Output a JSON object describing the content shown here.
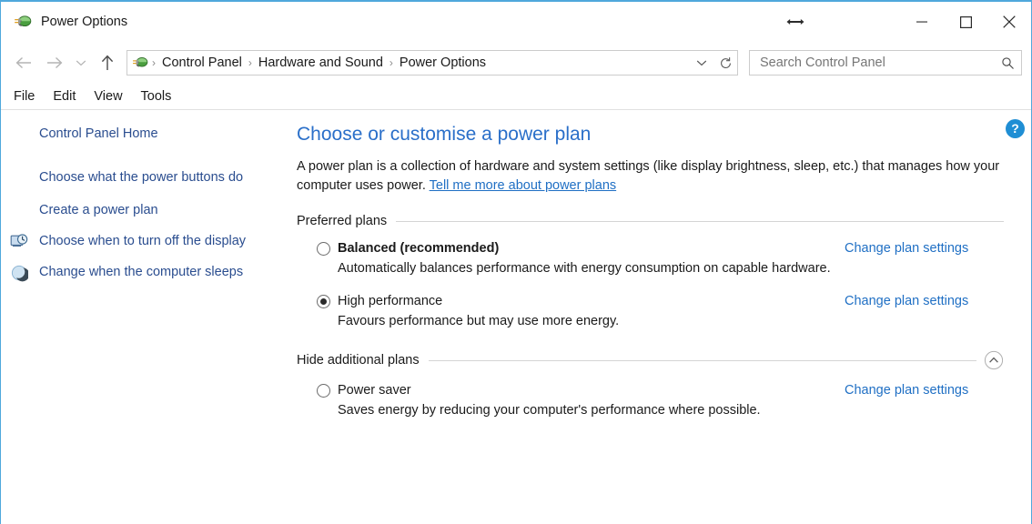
{
  "window": {
    "title": "Power Options",
    "title_icon": "power-plug-icon",
    "cursor": "horizontal-resize-cursor",
    "controls": {
      "minimize": "minimize-icon",
      "maximize": "maximize-icon",
      "close": "close-icon"
    }
  },
  "nav": {
    "back": "back-arrow-icon",
    "forward": "forward-arrow-icon",
    "recent": "chevron-down-icon",
    "up": "up-arrow-icon",
    "crumb_icon": "power-plug-icon",
    "breadcrumbs": [
      "Control Panel",
      "Hardware and Sound",
      "Power Options"
    ],
    "separator": "›",
    "dropdown": "chevron-down-icon",
    "refresh": "refresh-icon"
  },
  "search": {
    "placeholder": "Search Control Panel",
    "value": "",
    "icon": "search-icon"
  },
  "menu": {
    "items": [
      "File",
      "Edit",
      "View",
      "Tools"
    ]
  },
  "sidebar": {
    "items": [
      {
        "label": "Control Panel Home",
        "icon": ""
      },
      {
        "label": "Choose what the power buttons do",
        "icon": ""
      },
      {
        "label": "Create a power plan",
        "icon": ""
      },
      {
        "label": "Choose when to turn off the display",
        "icon": "display-clock-icon"
      },
      {
        "label": "Change when the computer sleeps",
        "icon": "moon-sleep-icon"
      }
    ]
  },
  "content": {
    "help_button": "?",
    "title": "Choose or customise a power plan",
    "description_prefix": "A power plan is a collection of hardware and system settings (like display brightness, sleep, etc.) that manages how your computer uses power. ",
    "description_link": "Tell me more about power plans",
    "preferred_group": {
      "label": "Preferred plans",
      "plans": [
        {
          "name": "Balanced (recommended)",
          "selected": false,
          "bold": true,
          "description": "Automatically balances performance with energy consumption on capable hardware.",
          "link": "Change plan settings"
        },
        {
          "name": "High performance",
          "selected": true,
          "bold": false,
          "description": "Favours performance but may use more energy.",
          "link": "Change plan settings"
        }
      ]
    },
    "additional_group": {
      "label": "Hide additional plans",
      "toggle_icon": "chevron-up-circle-icon",
      "plans": [
        {
          "name": "Power saver",
          "selected": false,
          "bold": false,
          "description": "Saves energy by reducing your computer's performance where possible.",
          "link": "Change plan settings"
        }
      ]
    }
  },
  "colors": {
    "window_border": "#4fa8dc",
    "title_link": "#2a6fc9",
    "sidebar_link": "#2a4d8f",
    "hyperlink": "#1f6fc4",
    "help_blue": "#1f8ed4"
  }
}
